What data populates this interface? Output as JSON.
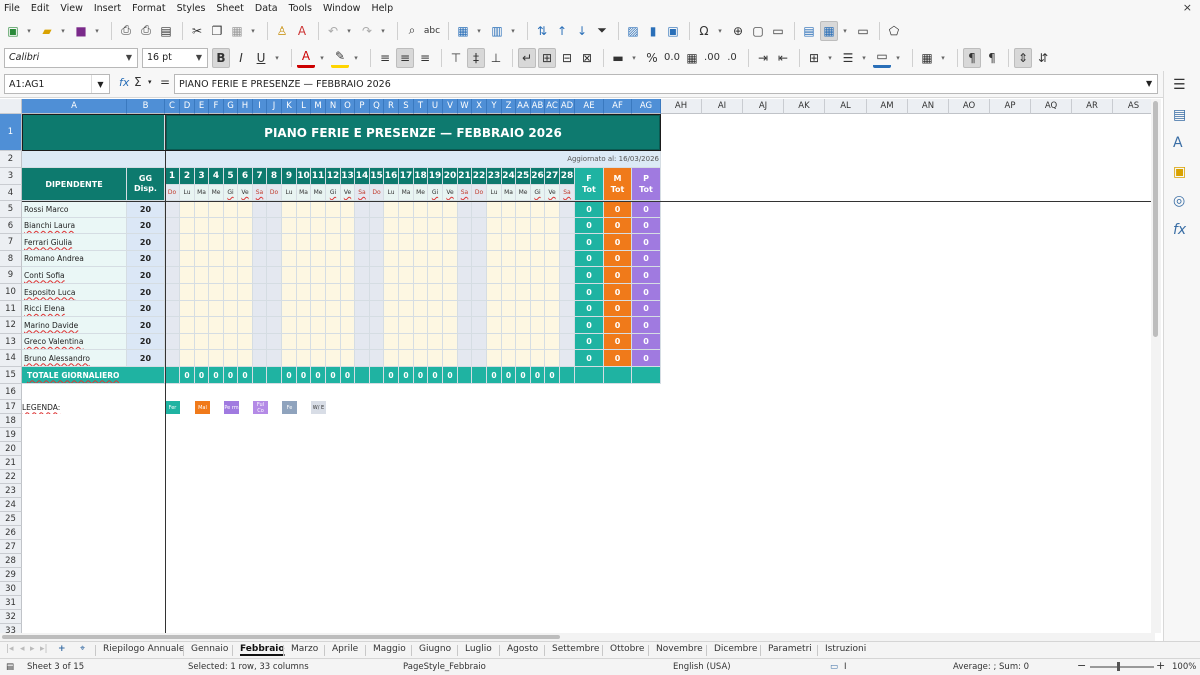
{
  "menubar": [
    "File",
    "Edit",
    "View",
    "Insert",
    "Format",
    "Styles",
    "Sheet",
    "Data",
    "Tools",
    "Window",
    "Help"
  ],
  "close_glyph": "×",
  "toolbar": {
    "font_name": "Calibri",
    "font_size": "16 pt"
  },
  "formula_bar": {
    "name_box": "A1:AG1",
    "fx": "fx",
    "sum": "Σ",
    "equals": "=",
    "content": "PIANO FERIE E PRESENZE — FEBBRAIO 2026"
  },
  "columns": [
    "A",
    "B",
    "C",
    "D",
    "E",
    "F",
    "G",
    "H",
    "I",
    "J",
    "K",
    "L",
    "M",
    "N",
    "O",
    "P",
    "Q",
    "R",
    "S",
    "T",
    "U",
    "V",
    "W",
    "X",
    "Y",
    "Z",
    "AA",
    "AB",
    "AC",
    "AD",
    "AE",
    "AF",
    "AG",
    "AH",
    "AI",
    "AJ",
    "AK",
    "AL",
    "AM",
    "AN",
    "AO",
    "AP",
    "AQ",
    "AR",
    "AS"
  ],
  "sheet": {
    "title": "PIANO FERIE E PRESENZE — FEBBRAIO 2026",
    "updated": "Aggiornato al: 16/03/2026",
    "dipendente_header": "DIPENDENTE",
    "gg_header": "GG Disp.",
    "days": [
      "1",
      "2",
      "3",
      "4",
      "5",
      "6",
      "7",
      "8",
      "9",
      "10",
      "11",
      "12",
      "13",
      "14",
      "15",
      "16",
      "17",
      "18",
      "19",
      "20",
      "21",
      "22",
      "23",
      "24",
      "25",
      "26",
      "27",
      "28"
    ],
    "weekdays": [
      "Do",
      "Lu",
      "Ma",
      "Me",
      "Gi",
      "Ve",
      "Sa",
      "Do",
      "Lu",
      "Ma",
      "Me",
      "Gi",
      "Ve",
      "Sa",
      "Do",
      "Lu",
      "Ma",
      "Me",
      "Gi",
      "Ve",
      "Sa",
      "Do",
      "Lu",
      "Ma",
      "Me",
      "Gi",
      "Ve",
      "Sa"
    ],
    "tot_headers": [
      {
        "label": "F\nTot",
        "color": "#1fb3a2"
      },
      {
        "label": "M\nTot",
        "color": "#f07a1a"
      },
      {
        "label": "P\nTot",
        "color": "#a07ae0"
      }
    ],
    "employees": [
      {
        "name": "Rossi Marco",
        "gg": "20",
        "f": "0",
        "m": "0",
        "p": "0"
      },
      {
        "name": "Bianchi Laura",
        "gg": "20",
        "f": "0",
        "m": "0",
        "p": "0"
      },
      {
        "name": "Ferrari Giulia",
        "gg": "20",
        "f": "0",
        "m": "0",
        "p": "0"
      },
      {
        "name": "Romano Andrea",
        "gg": "20",
        "f": "0",
        "m": "0",
        "p": "0"
      },
      {
        "name": "Conti Sofia",
        "gg": "20",
        "f": "0",
        "m": "0",
        "p": "0"
      },
      {
        "name": "Esposito Luca",
        "gg": "20",
        "f": "0",
        "m": "0",
        "p": "0"
      },
      {
        "name": "Ricci Elena",
        "gg": "20",
        "f": "0",
        "m": "0",
        "p": "0"
      },
      {
        "name": "Marino Davide",
        "gg": "20",
        "f": "0",
        "m": "0",
        "p": "0"
      },
      {
        "name": "Greco Valentina",
        "gg": "20",
        "f": "0",
        "m": "0",
        "p": "0"
      },
      {
        "name": "Bruno Alessandro",
        "gg": "20",
        "f": "0",
        "m": "0",
        "p": "0"
      }
    ],
    "total_label": "TOTALE GIORNALIERO",
    "daily_totals": [
      "",
      "0",
      "0",
      "0",
      "0",
      "0",
      "",
      "",
      "0",
      "0",
      "0",
      "0",
      "0",
      "",
      "",
      "0",
      "0",
      "0",
      "0",
      "0",
      "",
      "",
      "0",
      "0",
      "0",
      "0",
      "0",
      ""
    ],
    "legend_label": "LEGENDA:",
    "legend": [
      {
        "text": "Fer",
        "color": "#1fb3a2"
      },
      {
        "text": "Mal",
        "color": "#f07a1a"
      },
      {
        "text": "Pe rm",
        "color": "#a07ae0"
      },
      {
        "text": "Ful Co",
        "color": "#b48ae6"
      },
      {
        "text": "Fe",
        "color": "#8fa3bd"
      },
      {
        "text": "W/ E",
        "color": "#d8dde6"
      }
    ],
    "row_numbers": [
      "1",
      "2",
      "3",
      "4",
      "5",
      "6",
      "7",
      "8",
      "9",
      "10",
      "11",
      "12",
      "13",
      "14",
      "15",
      "16",
      "17",
      "18",
      "19",
      "20",
      "21",
      "22",
      "23",
      "24",
      "25",
      "26",
      "27",
      "28",
      "29",
      "30",
      "31",
      "32",
      "33"
    ]
  },
  "sheet_tabs": [
    "Riepilogo Annuale",
    "Gennaio",
    "Febbraio",
    "Marzo",
    "Aprile",
    "Maggio",
    "Giugno",
    "Luglio",
    "Agosto",
    "Settembre",
    "Ottobre",
    "Novembre",
    "Dicembre",
    "Parametri",
    "Istruzioni"
  ],
  "active_tab": "Febbraio",
  "status": {
    "sheet": "Sheet 3 of 15",
    "selected": "Selected: 1 row, 33 columns",
    "page_style": "PageStyle_Febbraio",
    "language": "English (USA)",
    "summary": "Average: ; Sum: 0",
    "zoom_minus": "−",
    "zoom_plus": "+",
    "zoom": "100%"
  },
  "colors": {
    "header_teal": "#0d7a6e",
    "title_teal": "#0e7a6f",
    "gg_blue_bg": "#dbe7f6",
    "name_bg": "#eaf7f6",
    "weekday_bg": "#fdf7e2",
    "weekend_bg": "#e4e8f0",
    "total_row": "#1fb3a2",
    "selection": "#4f8fd6"
  }
}
